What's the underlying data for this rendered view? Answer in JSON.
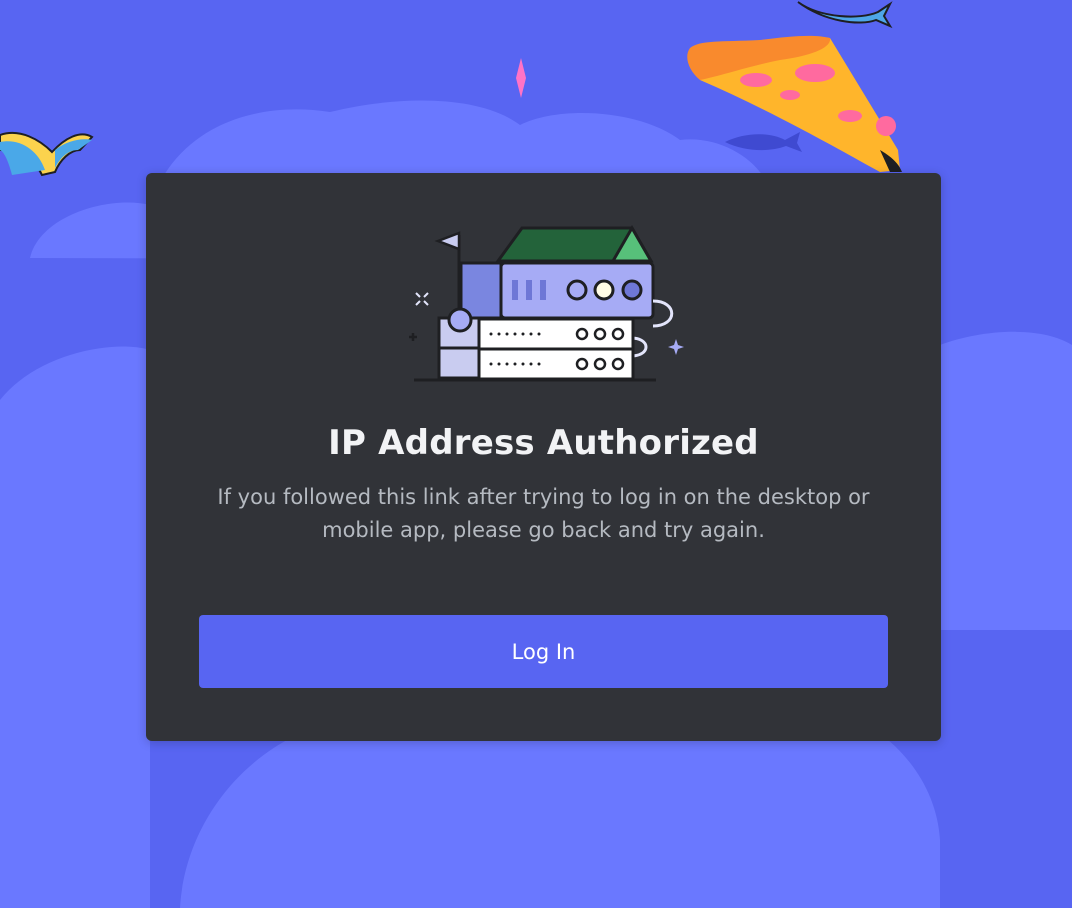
{
  "page": {
    "title": "IP Address Authorized",
    "description": "If you followed this link after trying to log in on the desktop or mobile app, please go back and try again.",
    "login_button_label": "Log In"
  },
  "colors": {
    "background": "#5865f2",
    "card": "#313338",
    "button": "#5865f2",
    "title_text": "#f2f3f5",
    "description_text": "#b5bac1"
  },
  "icons": {
    "illustration": "server-house-illustration",
    "decorations": [
      "book-icon",
      "pizza-icon",
      "fish-icon",
      "sparkle-icon"
    ]
  }
}
